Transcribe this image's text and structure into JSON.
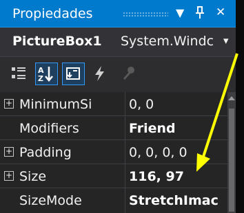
{
  "window": {
    "title": "Propiedades",
    "dropdown_icon": "▼",
    "pin_icon": "Ӿ",
    "close_icon": "✕"
  },
  "object": {
    "name": "PictureBox1",
    "type": "System.Windc",
    "dropdown_icon": "▾"
  },
  "toolbar": {
    "categorized_icon": "categorized-icon",
    "alphabetical_icon": "alphabetical-icon",
    "properties_icon": "properties-icon",
    "events_icon": "events-icon",
    "property_pages_icon": "property-pages-icon"
  },
  "properties": [
    {
      "name": "MinimumSi",
      "value": "0, 0",
      "expandable": true,
      "bold": false
    },
    {
      "name": "Modifiers",
      "value": "Friend",
      "expandable": false,
      "bold": true
    },
    {
      "name": "Padding",
      "value": "0, 0, 0, 0",
      "expandable": true,
      "bold": false
    },
    {
      "name": "Size",
      "value": "116, 97",
      "expandable": true,
      "bold": true
    },
    {
      "name": "SizeMode",
      "value": "StretchImac",
      "expandable": false,
      "bold": true
    }
  ],
  "colors": {
    "accent": "#007acc",
    "annotation": "#ffff00",
    "background": "#252526"
  }
}
